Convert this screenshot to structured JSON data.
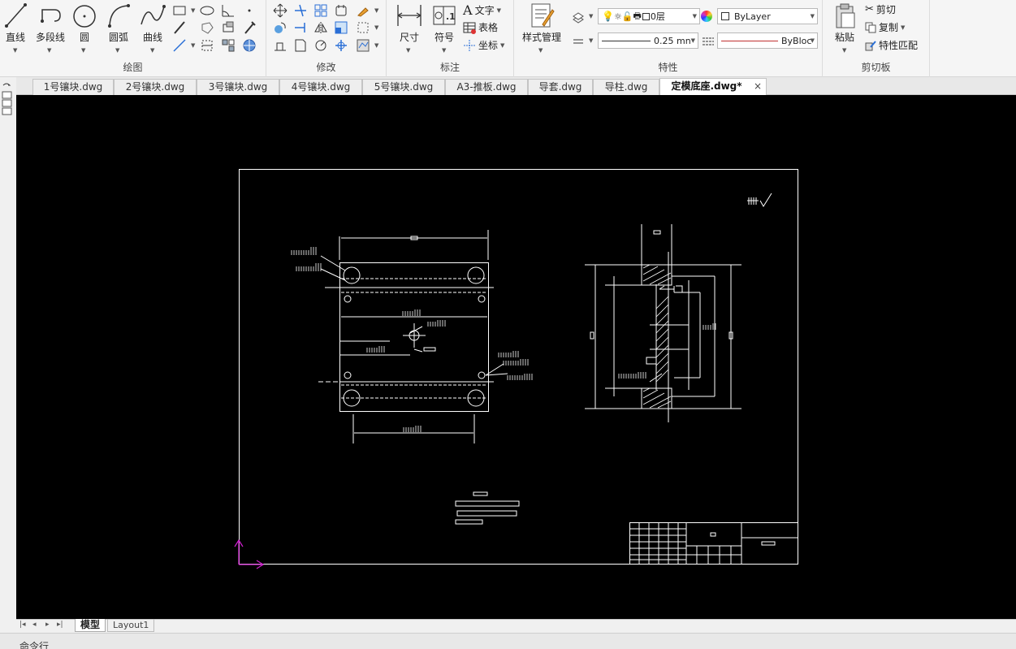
{
  "ribbon": {
    "draw": {
      "label": "绘图",
      "line": "直线",
      "polyline": "多段线",
      "circle": "圆",
      "arc": "圆弧",
      "curve": "曲线"
    },
    "modify": {
      "label": "修改"
    },
    "annotation": {
      "label": "标注",
      "dimension": "尺寸",
      "symbol": "符号",
      "text": "文字",
      "table": "表格",
      "coordinate": "坐标"
    },
    "properties": {
      "label": "特性",
      "style_manager": "样式管理",
      "layer": "0层",
      "color": "ByLayer",
      "lineweight": "0.25 mn",
      "linetype": "ByBloc"
    },
    "clipboard": {
      "label": "剪切板",
      "paste": "粘贴",
      "cut": "剪切",
      "copy": "复制",
      "match": "特性匹配"
    }
  },
  "tabs": [
    {
      "label": "1号镶块.dwg"
    },
    {
      "label": "2号镶块.dwg"
    },
    {
      "label": "3号镶块.dwg"
    },
    {
      "label": "4号镶块.dwg"
    },
    {
      "label": "5号镶块.dwg"
    },
    {
      "label": "A3-推板.dwg"
    },
    {
      "label": "导套.dwg"
    },
    {
      "label": "导柱.dwg"
    },
    {
      "label": "定模底座.dwg*",
      "active": true
    }
  ],
  "close_glyph": "×",
  "layout_tabs": {
    "model": "模型",
    "layout1": "Layout1"
  },
  "command_label": "命令行",
  "colors": {
    "canvas": "#000000",
    "ucs": "#d020d0",
    "line_red": "#c03030"
  }
}
